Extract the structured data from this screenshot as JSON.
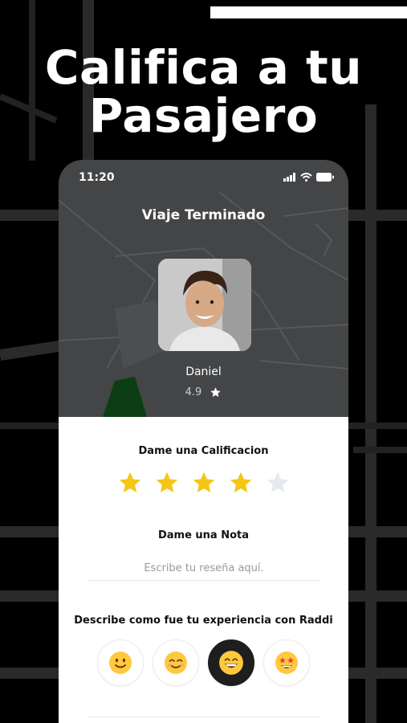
{
  "headline": {
    "line1": "Califica a tu",
    "line2": "Pasajero"
  },
  "status_bar": {
    "time": "11:20"
  },
  "screen": {
    "title": "Viaje Terminado",
    "passenger": {
      "name": "Daniel",
      "rating": "4.9"
    }
  },
  "rating_section": {
    "label": "Dame una Calificacion",
    "stars_filled": 4,
    "stars_total": 5,
    "star_color": "#F5C518",
    "star_empty_color": "#E6E9EF"
  },
  "note_section": {
    "label": "Dame una Nota",
    "placeholder": "Escribe tu reseña aquí."
  },
  "experience_section": {
    "label": "Describe como fue tu experiencia con Raddi",
    "options": [
      {
        "icon": "slightly-smiling-face-icon",
        "selected": false
      },
      {
        "icon": "smiling-relaxed-face-icon",
        "selected": false
      },
      {
        "icon": "grinning-face-icon",
        "selected": true
      },
      {
        "icon": "star-struck-face-icon",
        "selected": false
      }
    ]
  },
  "colors": {
    "background": "#000000",
    "phone": "#444547",
    "accent_dark": "#1E1E1E"
  }
}
